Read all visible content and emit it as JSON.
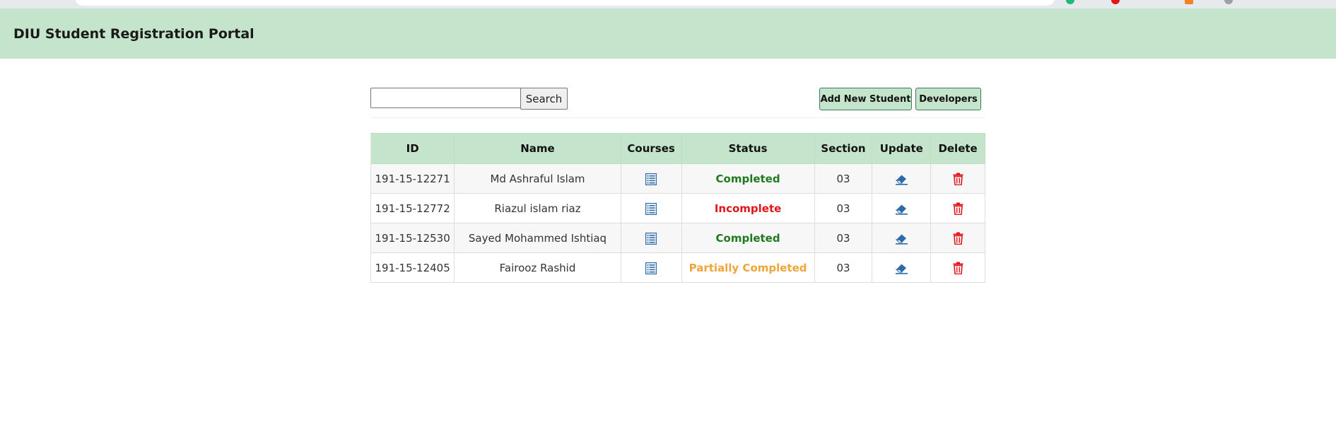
{
  "app": {
    "title": "DIU Student Registration Portal"
  },
  "toolbar": {
    "search_value": "",
    "search_label": "Search",
    "add_label": "Add New Student",
    "dev_label": "Developers"
  },
  "table": {
    "headers": [
      "ID",
      "Name",
      "Courses",
      "Status",
      "Section",
      "Update",
      "Delete"
    ],
    "rows": [
      {
        "id": "191-15-12271",
        "name": "Md Ashraful Islam",
        "status": "Completed",
        "section": "03"
      },
      {
        "id": "191-15-12772",
        "name": "Riazul islam riaz",
        "status": "Incomplete",
        "section": "03"
      },
      {
        "id": "191-15-12530",
        "name": "Sayed Mohammed Ishtiaq",
        "status": "Completed",
        "section": "03"
      },
      {
        "id": "191-15-12405",
        "name": "Fairooz Rashid",
        "status": "Partially Completed",
        "section": "03"
      }
    ]
  },
  "icons": {
    "courses": "list-icon",
    "update": "eraser-icon",
    "delete": "trash-icon"
  },
  "colors": {
    "header_bg": "#c4e5cb",
    "completed": "#1f7a1f",
    "incomplete": "#e0161c",
    "partial": "#f0a53a",
    "icon_blue": "#2d6aa8",
    "icon_red": "#e0161c"
  }
}
